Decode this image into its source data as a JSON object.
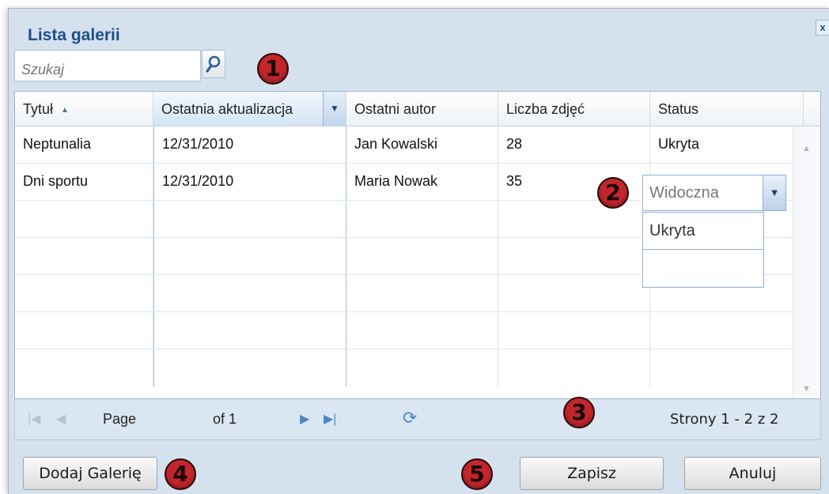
{
  "window": {
    "title": "Lista galerii",
    "close_label": "x"
  },
  "search": {
    "placeholder": "Szukaj"
  },
  "markers": [
    "1",
    "2",
    "3",
    "4",
    "5"
  ],
  "grid": {
    "columns": [
      "Tytuł",
      "Ostatnia aktualizacja",
      "Ostatni autor",
      "Liczba zdjęć",
      "Status"
    ],
    "rows": [
      [
        "Neptunalia",
        "12/31/2010",
        "Jan Kowalski",
        "28",
        "Ukryta"
      ],
      [
        "Dni sportu",
        "12/31/2010",
        "Maria Nowak",
        "35",
        ""
      ]
    ],
    "status_editor_value": "Widoczna",
    "status_options": [
      "Ukryta",
      ""
    ]
  },
  "pager": {
    "page_label": "Page",
    "of_label": "of 1",
    "summary": "Strony 1 - 2 z 2"
  },
  "footer": {
    "add_label": "Dodaj Galerię",
    "save_label": "Zapisz",
    "cancel_label": "Anuluj"
  },
  "colors": {
    "title": "#1e4e8a",
    "marker": "#c3262b",
    "accent": "#4a86c8"
  }
}
